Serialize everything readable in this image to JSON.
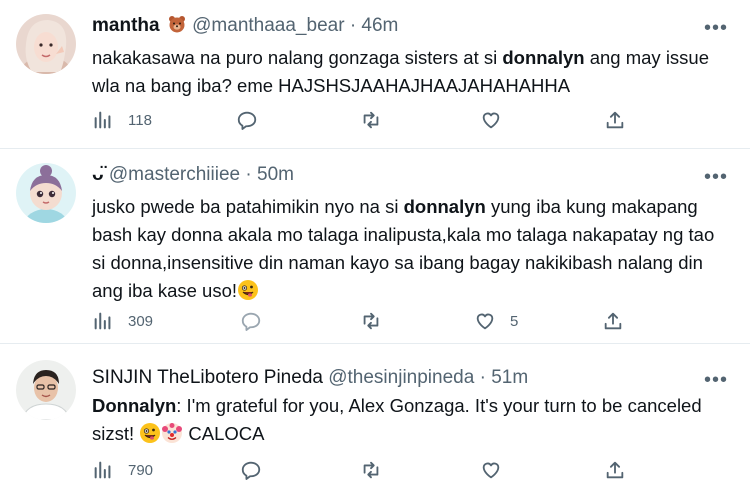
{
  "tweets": [
    {
      "name": "mantha",
      "handle": "@manthaaa_bear",
      "separator": "·",
      "time": "46m",
      "line1_pre": "nakakasawa na puro nalang gonzaga sisters at si ",
      "line1_bold": "donnalyn",
      "line1_post": " ang may issue",
      "line2": "wla na bang iba? eme HAJSHSJAAHAJHAAJAHAHAHHA",
      "views": "118",
      "likes": ""
    },
    {
      "name_glyph": "ᴗ̈",
      "handle": "@masterchiiiee",
      "separator": "·",
      "time": "50m",
      "line1_pre": "jusko pwede ba patahimikin nyo na si ",
      "line1_bold": "donnalyn",
      "line1_post": " yung iba kung makapang",
      "line2": "bash kay donna akala mo talaga inalipusta,kala mo talaga nakapatay ng tao",
      "line3": "si donna,insensitive din naman kayo sa ibang bagay nakikibash nalang din",
      "line4": "ang iba kase uso!",
      "views": "309",
      "likes": "5"
    },
    {
      "name": "SINJIN TheLibotero Pineda",
      "handle": "@thesinjinpineda",
      "separator": "·",
      "time": "51m",
      "line1_bold": "Donnalyn",
      "line1_post": ": I'm grateful for you, Alex Gonzaga. It's your turn to be canceled",
      "line2_pre": "sizst! ",
      "line2_post": " CALOCA",
      "views": "790",
      "likes": ""
    }
  ],
  "more_label": "•••",
  "icons": [
    "views-icon",
    "reply-icon",
    "retweet-icon",
    "like-icon",
    "share-icon"
  ],
  "colors": {
    "text": "#0f1419",
    "secondary": "#536471",
    "divider": "#e6ecf0"
  }
}
